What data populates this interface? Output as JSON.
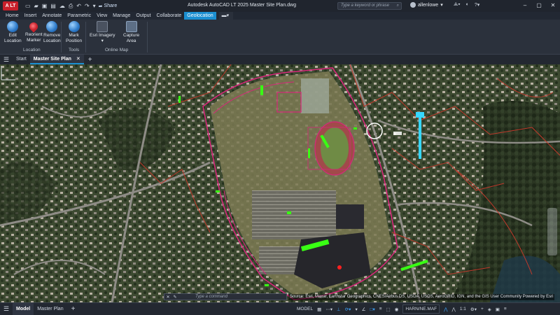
{
  "app": {
    "logo_text": "A LT",
    "title": "Autodesk AutoCAD LT 2025   Master Site Plan.dwg",
    "share_label": "Share",
    "search_placeholder": "Type a keyword or phrase",
    "username": "allenlowe"
  },
  "ribbon_tabs": [
    "Home",
    "Insert",
    "Annotate",
    "Parametric",
    "View",
    "Manage",
    "Output",
    "Collaborate",
    "Geolocation"
  ],
  "active_ribbon_tab": "Geolocation",
  "ribbon": {
    "buttons": {
      "edit_location": "Edit\nLocation",
      "reorient_marker": "Reorient\nMarker",
      "remove_location": "Remove\nLocation",
      "mark_position": "Mark\nPosition",
      "esri_imagery": "Esri Imagery",
      "capture_area": "Capture\nArea"
    },
    "groups": {
      "location": "Location",
      "tools": "Tools",
      "online_map": "Online Map"
    }
  },
  "doc_tabs": {
    "start": "Start",
    "active": "Master Site Plan"
  },
  "command_line": {
    "placeholder": "Type a command"
  },
  "map": {
    "attribution": "Source: Esri, Maxar, Earthstar Geographics, CNES/Airbus DS, USDA, USGS, AeroGRID, IGN, and the GIS User Community Powered by Esri"
  },
  "status_bar": {
    "model_tab": "Model",
    "layout_tab": "Master Plan",
    "space_label": "MODEL",
    "coordinate_system": "HARN/NE.MAF",
    "scale": "1:1"
  },
  "colors": {
    "accent": "#1b8fd1",
    "title_bar": "#20252e",
    "ribbon": "#2b313c",
    "site_boundary": "#d6277a",
    "highlight_green": "#39ff14",
    "marker_cyan": "#36d7ff"
  }
}
